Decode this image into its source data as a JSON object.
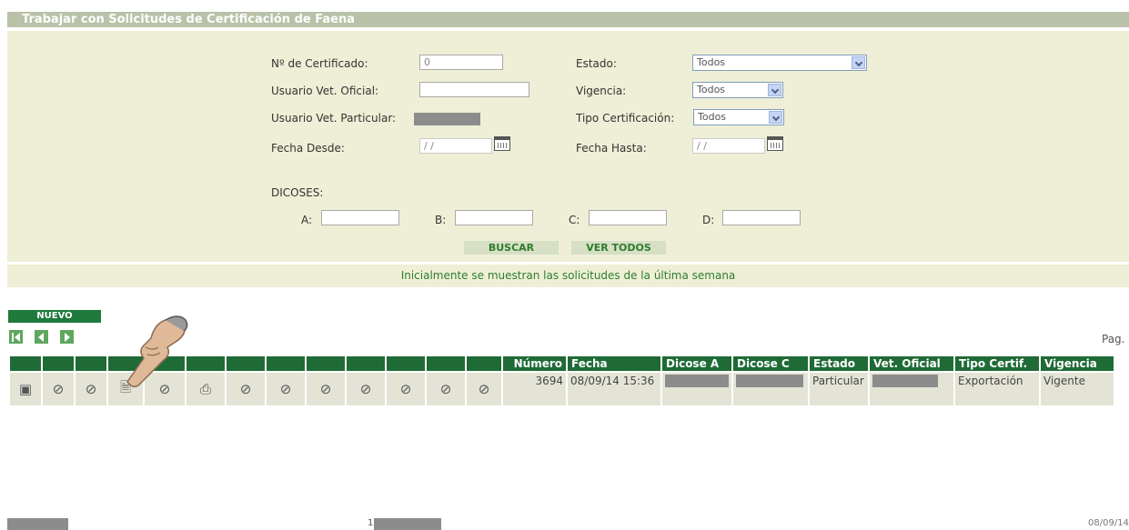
{
  "title": "Trabajar con Solicitudes de Certificación de Faena",
  "filters": {
    "cert_label": "Nº de Certificado:",
    "cert_value": "0",
    "estado_label": "Estado:",
    "estado_value": "Todos",
    "usuario_oficial_label": "Usuario Vet. Oficial:",
    "vigencia_label": "Vigencia:",
    "vigencia_value": "Todos",
    "usuario_particular_label": "Usuario Vet. Particular:",
    "tipo_cert_label": "Tipo Certificación:",
    "tipo_cert_value": "Todos",
    "fecha_desde_label": "Fecha Desde:",
    "fecha_desde_value": "/ /",
    "fecha_hasta_label": "Fecha Hasta:",
    "fecha_hasta_value": "/ /",
    "dicoses_label": "DICOSES:",
    "dicose_a_label": "A:",
    "dicose_b_label": "B:",
    "dicose_c_label": "C:",
    "dicose_d_label": "D:"
  },
  "buttons": {
    "buscar": "BUSCAR",
    "ver_todos": "VER TODOS",
    "nuevo": "NUEVO"
  },
  "message": "Inicialmente se muestran las solicitudes de la última semana",
  "pagination": {
    "label": "Pag."
  },
  "table": {
    "headers": [
      "Número",
      "Fecha",
      "Dicose A",
      "Dicose C",
      "Estado",
      "Vet. Oficial",
      "Tipo Certif.",
      "Vigencia"
    ],
    "rows": [
      {
        "numero": "3694",
        "fecha": "08/09/14 15:36",
        "estado": "Particular",
        "tipo": "Exportación",
        "vigencia": "Vigente"
      }
    ]
  },
  "icons": [
    "detail-icon",
    "disabled-icon",
    "disabled-icon",
    "certificate-download-icon",
    "disabled-icon",
    "print-icon",
    "disabled-icon",
    "disabled-icon",
    "disabled-icon",
    "disabled-icon",
    "disabled-icon",
    "disabled-icon",
    "disabled-icon"
  ],
  "footer": {
    "page_number": "1",
    "date": "08/09/14"
  },
  "colors": {
    "header_green": "#1f6b36",
    "panel_bg": "#efefd7",
    "title_bg": "#b9c2a8",
    "accent_text": "#2e7d2e"
  }
}
